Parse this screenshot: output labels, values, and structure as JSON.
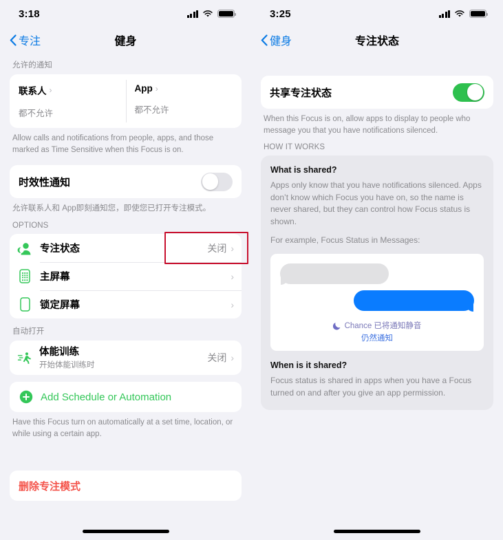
{
  "colors": {
    "accent_blue": "#0a7ae4",
    "green": "#34c759",
    "toggle_on": "#2ec04e",
    "destructive_red": "#f4544b",
    "highlight_red": "#c8102e",
    "bubble_blue": "#0a7cff",
    "bubble_gray": "#e1e1e3",
    "background": "#f2f2f7",
    "card": "#ffffff",
    "secondary_text": "#8a8a8e"
  },
  "left": {
    "statusbar": {
      "time": "3:18",
      "signal_icon": "cellular-bars-icon",
      "wifi_icon": "wifi-icon",
      "battery_icon": "battery-full-icon"
    },
    "nav": {
      "back_icon": "chevron-left-icon",
      "back_label": "专注",
      "title": "健身"
    },
    "allowed_header": "允许的通知",
    "allowed": [
      {
        "title": "联系人",
        "chevron": "›",
        "value": "都不允许"
      },
      {
        "title": "App",
        "chevron": "›",
        "value": "都不允许"
      }
    ],
    "allowed_footnote": "Allow calls and notifications from people, apps, and those marked as Time Sensitive when this Focus is on.",
    "time_sensitive": {
      "label": "时效性通知",
      "toggle_state": "off",
      "footnote": "允许联系人和 App即刻通知您，即使您已打开专注模式。"
    },
    "options_header": "OPTIONS",
    "options": [
      {
        "icon": "focus-status-person-icon",
        "label": "专注状态",
        "value": "关闭",
        "chevron": "›",
        "highlighted": true
      },
      {
        "icon": "home-screen-icon",
        "label": "主屏幕",
        "value": "",
        "chevron": "›",
        "highlighted": false
      },
      {
        "icon": "lock-screen-icon",
        "label": "锁定屏幕",
        "value": "",
        "chevron": "›",
        "highlighted": false
      }
    ],
    "auto_header": "自动打开",
    "automation": {
      "icon": "running-person-icon",
      "title": "体能训练",
      "subtitle": "开始体能训练时",
      "value": "关闭",
      "chevron": "›"
    },
    "add_schedule": {
      "icon": "plus-circle-icon",
      "label": "Add Schedule or Automation"
    },
    "auto_footnote": "Have this Focus turn on automatically at a set time, location, or while using a certain app.",
    "delete_label": "删除专注模式"
  },
  "right": {
    "statusbar": {
      "time": "3:25",
      "signal_icon": "cellular-bars-icon",
      "wifi_icon": "wifi-icon",
      "battery_icon": "battery-full-icon"
    },
    "nav": {
      "back_icon": "chevron-left-icon",
      "back_label": "健身",
      "title": "专注状态"
    },
    "share_row": {
      "label": "共享专注状态",
      "toggle_state": "on"
    },
    "share_footnote": "When this Focus is on, allow apps to display to people who message you that you have notifications silenced.",
    "how_it_works_header": "HOW IT WORKS",
    "what_is_shared": {
      "heading": "What is shared?",
      "paragraph1": "Apps only know that you have notifications silenced. Apps don’t know which Focus you have on, so the name is never shared, but they can control how Focus status is shown.",
      "paragraph2": "For example, Focus Status in Messages:"
    },
    "message_preview": {
      "incoming_bubble": "incoming-message-bubble",
      "outgoing_bubble": "outgoing-message-bubble",
      "moon_icon": "crescent-moon-icon",
      "status_text": "Chance 已将通知静音",
      "notify_anyway": "仍然通知"
    },
    "when_is_it_shared": {
      "heading": "When is it shared?",
      "paragraph": "Focus status is shared in apps when you have a Focus turned on and after you give an app permission."
    }
  }
}
